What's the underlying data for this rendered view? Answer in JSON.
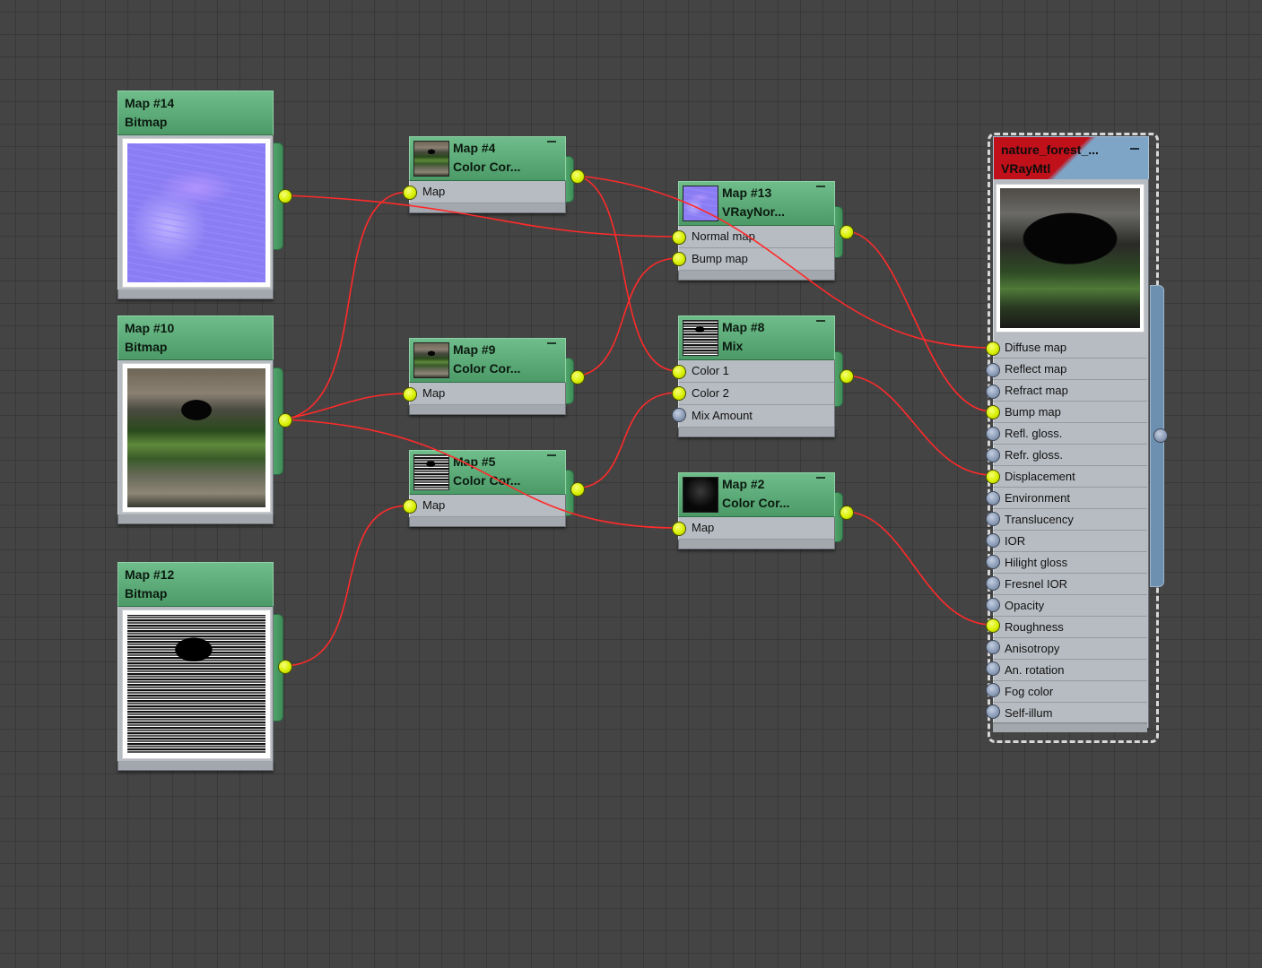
{
  "editor": {
    "wire_color": "#ff2a2a",
    "node_header_color": "#5aa873",
    "socket_on_color": "#d8f000",
    "socket_off_color": "#8a9ab5"
  },
  "nodes": {
    "map14": {
      "title": "Map #14",
      "subtitle": "Bitmap",
      "texture": "normal-map"
    },
    "map10": {
      "title": "Map #10",
      "subtitle": "Bitmap",
      "texture": "forest-diffuse"
    },
    "map12": {
      "title": "Map #12",
      "subtitle": "Bitmap",
      "texture": "roughness-map"
    },
    "map4": {
      "title": "Map #4",
      "subtitle": "Color Cor...",
      "inputs": [
        "Map"
      ]
    },
    "map9": {
      "title": "Map #9",
      "subtitle": "Color Cor...",
      "inputs": [
        "Map"
      ]
    },
    "map5": {
      "title": "Map #5",
      "subtitle": "Color Cor...",
      "inputs": [
        "Map"
      ]
    },
    "map13": {
      "title": "Map #13",
      "subtitle": "VRayNor...",
      "inputs": [
        "Normal map",
        "Bump map"
      ]
    },
    "map8": {
      "title": "Map #8",
      "subtitle": "Mix",
      "inputs": [
        "Color 1",
        "Color 2",
        "Mix Amount"
      ]
    },
    "map2": {
      "title": "Map #2",
      "subtitle": "Color Cor...",
      "inputs": [
        "Map"
      ]
    }
  },
  "material": {
    "title": "nature_forest_...",
    "subtitle": "VRayMtl",
    "slots": [
      "Diffuse map",
      "Reflect map",
      "Refract map",
      "Bump map",
      "Refl. gloss.",
      "Refr. gloss.",
      "Displacement",
      "Environment",
      "Translucency",
      "IOR",
      "Hilight gloss",
      "Fresnel IOR",
      "Opacity",
      "Roughness",
      "Anisotropy",
      "An. rotation",
      "Fog color",
      "Self-illum"
    ],
    "connected_slots": [
      "Diffuse map",
      "Bump map",
      "Displacement",
      "Roughness"
    ]
  }
}
